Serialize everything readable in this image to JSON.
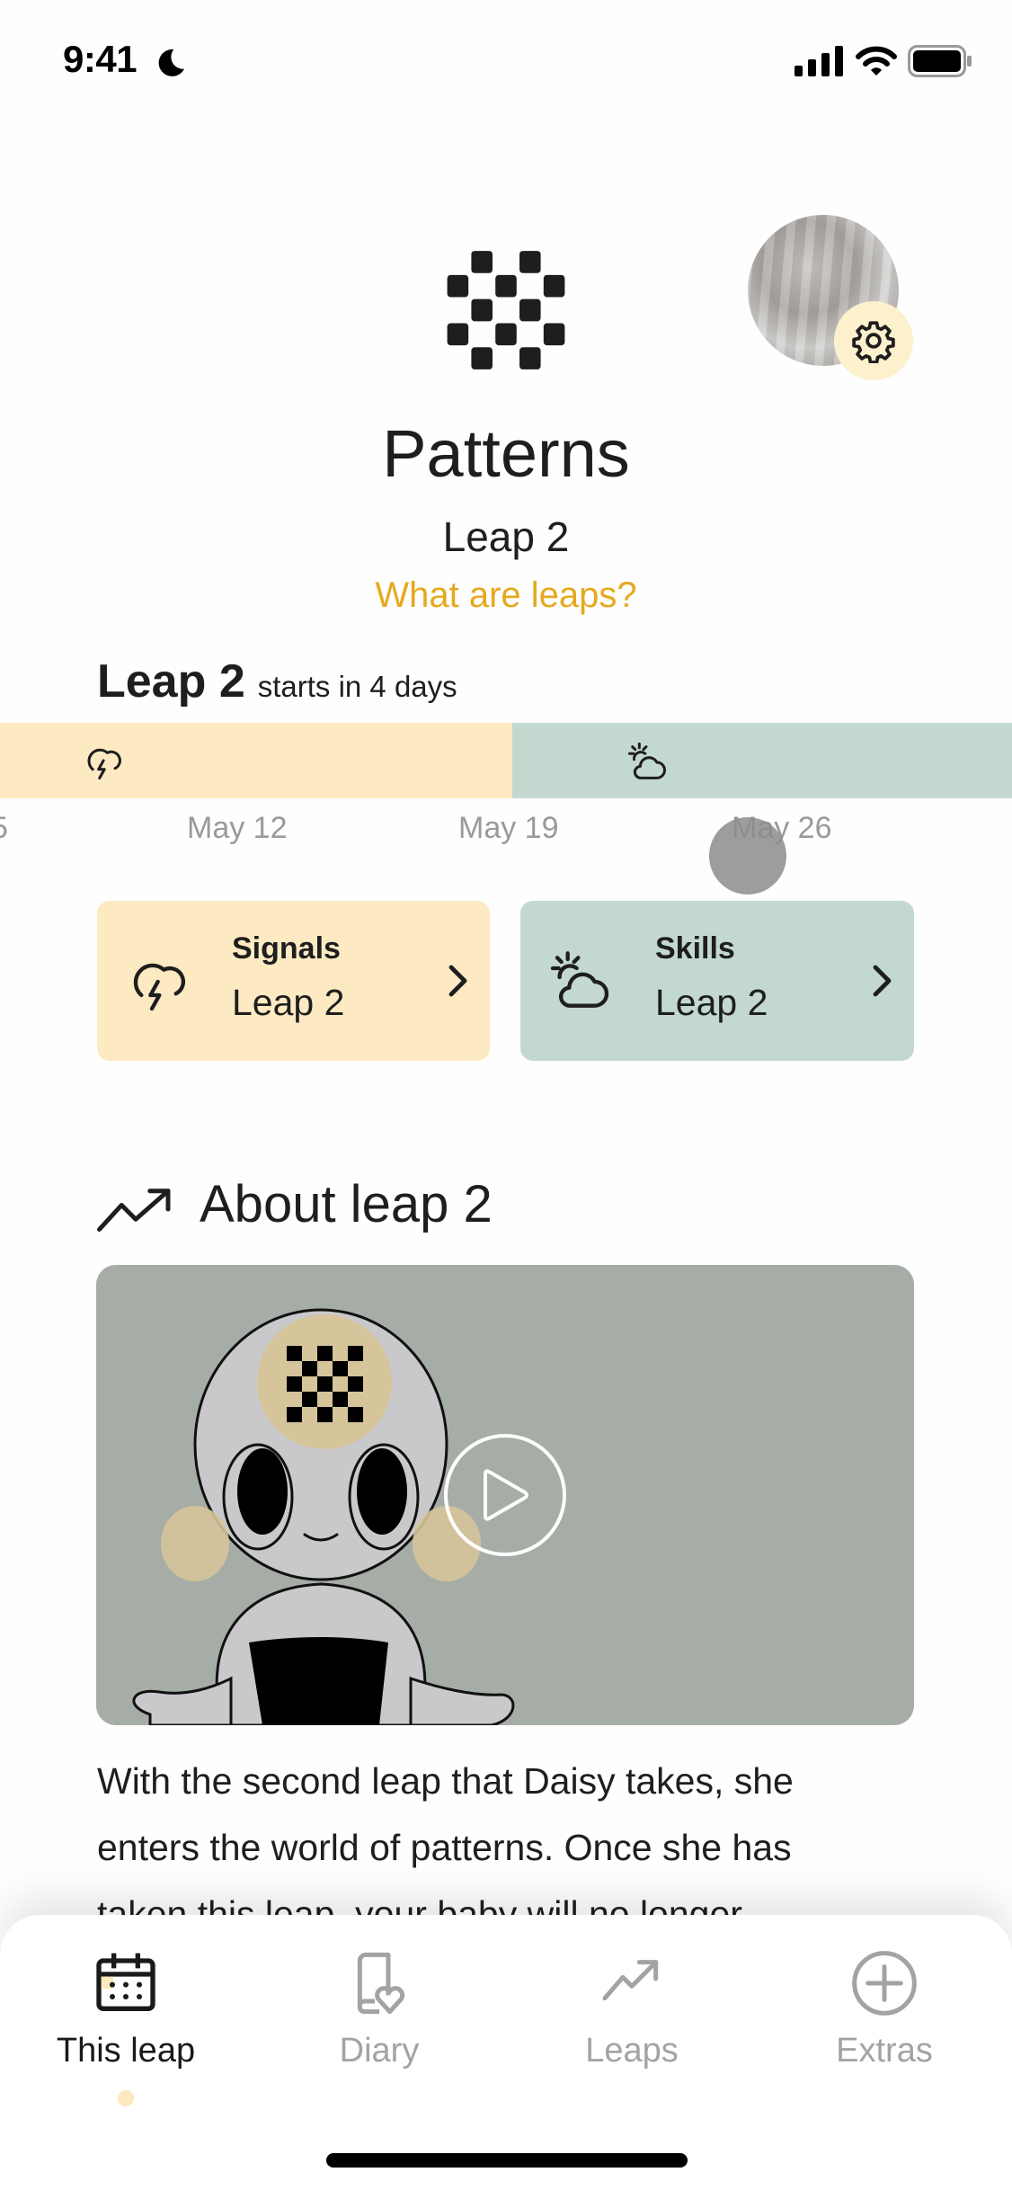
{
  "status_bar": {
    "time": "9:41",
    "focus_icon": "moon-icon",
    "icons": [
      "cellular-signal-icon",
      "wifi-icon",
      "battery-icon"
    ]
  },
  "header": {
    "leap_icon": "checkerboard-pattern-icon",
    "title": "Patterns",
    "subtitle": "Leap 2",
    "info_link": "What are leaps?",
    "settings_icon": "gear-icon"
  },
  "timeline": {
    "heading_bold": "Leap 2",
    "heading_rest": "starts in 4 days",
    "phases": [
      {
        "name": "signals",
        "icon": "storm-cloud-icon",
        "color": "#FDEAC2"
      },
      {
        "name": "skills",
        "icon": "sun-cloud-icon",
        "color": "#C3D8CF"
      }
    ],
    "dates": [
      "5",
      "May 12",
      "May 19",
      "May 26"
    ]
  },
  "cards": [
    {
      "title": "Signals",
      "subtitle": "Leap 2",
      "icon": "storm-cloud-icon",
      "color": "#FDEAC2"
    },
    {
      "title": "Skills",
      "subtitle": "Leap 2",
      "icon": "sun-cloud-icon",
      "color": "#C3D8CF"
    }
  ],
  "about": {
    "title": "About leap 2",
    "icon": "trending-up-icon",
    "video_play_icon": "play-icon",
    "paragraph_lines": [
      "With the second leap that Daisy  takes, she",
      "enters the world of patterns. Once she has",
      "taken this leap, your baby will no longer"
    ]
  },
  "bottom_nav": {
    "items": [
      {
        "label": "This leap",
        "icon": "calendar-icon",
        "active": true
      },
      {
        "label": "Diary",
        "icon": "diary-heart-icon",
        "active": false
      },
      {
        "label": "Leaps",
        "icon": "trending-up-icon",
        "active": false
      },
      {
        "label": "Extras",
        "icon": "plus-circle-icon",
        "active": false
      }
    ]
  },
  "colors": {
    "accent": "#E5A91F",
    "signals": "#FDEAC2",
    "skills": "#C3D8CF",
    "video_bg": "#A6ADA6"
  }
}
